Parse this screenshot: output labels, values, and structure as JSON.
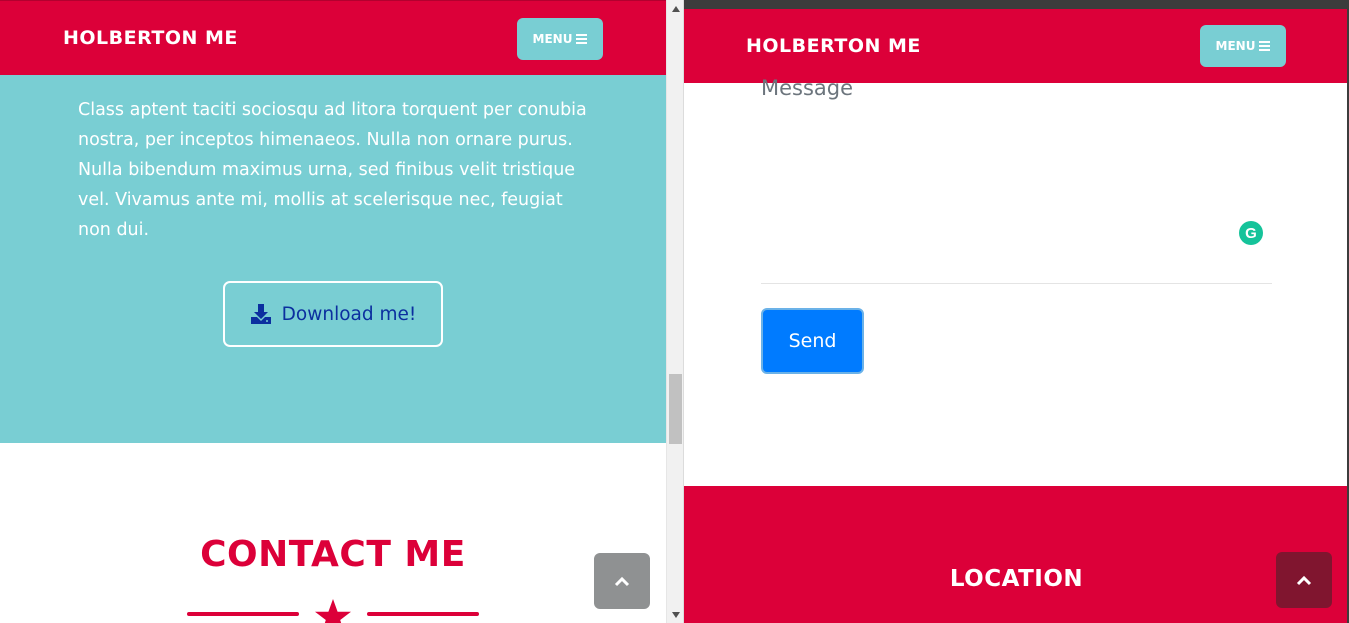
{
  "left": {
    "navbar": {
      "brand": "HOLBERTON ME",
      "menu_label": "MENU"
    },
    "about": {
      "paragraph": "Class aptent taciti sociosqu ad litora torquent per conubia nostra, per inceptos himenaeos. Nulla non ornare purus. Nulla bibendum maximus urna, sed finibus velit tristique vel. Vivamus ante mi, mollis at scelerisque nec, feugiat non dui.",
      "download_label": "Download me!"
    },
    "contact": {
      "title": "CONTACT ME"
    }
  },
  "right": {
    "navbar": {
      "brand": "HOLBERTON ME",
      "menu_label": "MENU"
    },
    "form": {
      "message_placeholder": "Message",
      "send_label": "Send"
    },
    "location": {
      "title": "LOCATION"
    }
  },
  "icons": {
    "menu": "hamburger-icon",
    "download": "download-icon",
    "star": "star-icon",
    "scroll_top": "chevron-up-icon",
    "grammarly": "grammarly-icon"
  },
  "colors": {
    "primary": "#dc0039",
    "secondary": "#79ced3",
    "button_blue": "#007bff",
    "scroll_top_gray": "#8f9192",
    "scroll_top_dark": "#80152f"
  }
}
